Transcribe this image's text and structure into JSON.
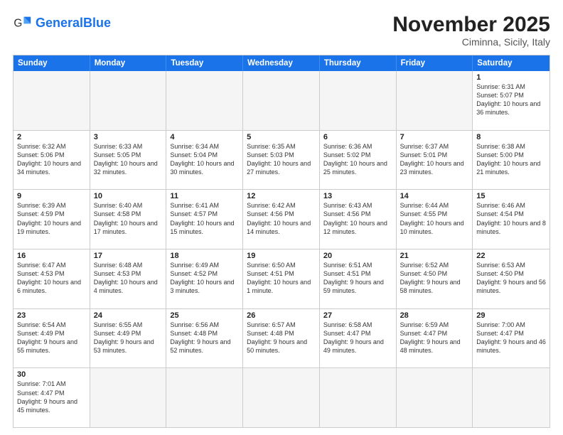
{
  "header": {
    "logo_general": "General",
    "logo_blue": "Blue",
    "month": "November 2025",
    "location": "Ciminna, Sicily, Italy"
  },
  "weekdays": [
    "Sunday",
    "Monday",
    "Tuesday",
    "Wednesday",
    "Thursday",
    "Friday",
    "Saturday"
  ],
  "weeks": [
    [
      {
        "day": "",
        "info": "",
        "empty": true
      },
      {
        "day": "",
        "info": "",
        "empty": true
      },
      {
        "day": "",
        "info": "",
        "empty": true
      },
      {
        "day": "",
        "info": "",
        "empty": true
      },
      {
        "day": "",
        "info": "",
        "empty": true
      },
      {
        "day": "",
        "info": "",
        "empty": true
      },
      {
        "day": "1",
        "info": "Sunrise: 6:31 AM\nSunset: 5:07 PM\nDaylight: 10 hours\nand 36 minutes.",
        "empty": false
      }
    ],
    [
      {
        "day": "2",
        "info": "Sunrise: 6:32 AM\nSunset: 5:06 PM\nDaylight: 10 hours\nand 34 minutes.",
        "empty": false
      },
      {
        "day": "3",
        "info": "Sunrise: 6:33 AM\nSunset: 5:05 PM\nDaylight: 10 hours\nand 32 minutes.",
        "empty": false
      },
      {
        "day": "4",
        "info": "Sunrise: 6:34 AM\nSunset: 5:04 PM\nDaylight: 10 hours\nand 30 minutes.",
        "empty": false
      },
      {
        "day": "5",
        "info": "Sunrise: 6:35 AM\nSunset: 5:03 PM\nDaylight: 10 hours\nand 27 minutes.",
        "empty": false
      },
      {
        "day": "6",
        "info": "Sunrise: 6:36 AM\nSunset: 5:02 PM\nDaylight: 10 hours\nand 25 minutes.",
        "empty": false
      },
      {
        "day": "7",
        "info": "Sunrise: 6:37 AM\nSunset: 5:01 PM\nDaylight: 10 hours\nand 23 minutes.",
        "empty": false
      },
      {
        "day": "8",
        "info": "Sunrise: 6:38 AM\nSunset: 5:00 PM\nDaylight: 10 hours\nand 21 minutes.",
        "empty": false
      }
    ],
    [
      {
        "day": "9",
        "info": "Sunrise: 6:39 AM\nSunset: 4:59 PM\nDaylight: 10 hours\nand 19 minutes.",
        "empty": false
      },
      {
        "day": "10",
        "info": "Sunrise: 6:40 AM\nSunset: 4:58 PM\nDaylight: 10 hours\nand 17 minutes.",
        "empty": false
      },
      {
        "day": "11",
        "info": "Sunrise: 6:41 AM\nSunset: 4:57 PM\nDaylight: 10 hours\nand 15 minutes.",
        "empty": false
      },
      {
        "day": "12",
        "info": "Sunrise: 6:42 AM\nSunset: 4:56 PM\nDaylight: 10 hours\nand 14 minutes.",
        "empty": false
      },
      {
        "day": "13",
        "info": "Sunrise: 6:43 AM\nSunset: 4:56 PM\nDaylight: 10 hours\nand 12 minutes.",
        "empty": false
      },
      {
        "day": "14",
        "info": "Sunrise: 6:44 AM\nSunset: 4:55 PM\nDaylight: 10 hours\nand 10 minutes.",
        "empty": false
      },
      {
        "day": "15",
        "info": "Sunrise: 6:46 AM\nSunset: 4:54 PM\nDaylight: 10 hours\nand 8 minutes.",
        "empty": false
      }
    ],
    [
      {
        "day": "16",
        "info": "Sunrise: 6:47 AM\nSunset: 4:53 PM\nDaylight: 10 hours\nand 6 minutes.",
        "empty": false
      },
      {
        "day": "17",
        "info": "Sunrise: 6:48 AM\nSunset: 4:53 PM\nDaylight: 10 hours\nand 4 minutes.",
        "empty": false
      },
      {
        "day": "18",
        "info": "Sunrise: 6:49 AM\nSunset: 4:52 PM\nDaylight: 10 hours\nand 3 minutes.",
        "empty": false
      },
      {
        "day": "19",
        "info": "Sunrise: 6:50 AM\nSunset: 4:51 PM\nDaylight: 10 hours\nand 1 minute.",
        "empty": false
      },
      {
        "day": "20",
        "info": "Sunrise: 6:51 AM\nSunset: 4:51 PM\nDaylight: 9 hours\nand 59 minutes.",
        "empty": false
      },
      {
        "day": "21",
        "info": "Sunrise: 6:52 AM\nSunset: 4:50 PM\nDaylight: 9 hours\nand 58 minutes.",
        "empty": false
      },
      {
        "day": "22",
        "info": "Sunrise: 6:53 AM\nSunset: 4:50 PM\nDaylight: 9 hours\nand 56 minutes.",
        "empty": false
      }
    ],
    [
      {
        "day": "23",
        "info": "Sunrise: 6:54 AM\nSunset: 4:49 PM\nDaylight: 9 hours\nand 55 minutes.",
        "empty": false
      },
      {
        "day": "24",
        "info": "Sunrise: 6:55 AM\nSunset: 4:49 PM\nDaylight: 9 hours\nand 53 minutes.",
        "empty": false
      },
      {
        "day": "25",
        "info": "Sunrise: 6:56 AM\nSunset: 4:48 PM\nDaylight: 9 hours\nand 52 minutes.",
        "empty": false
      },
      {
        "day": "26",
        "info": "Sunrise: 6:57 AM\nSunset: 4:48 PM\nDaylight: 9 hours\nand 50 minutes.",
        "empty": false
      },
      {
        "day": "27",
        "info": "Sunrise: 6:58 AM\nSunset: 4:47 PM\nDaylight: 9 hours\nand 49 minutes.",
        "empty": false
      },
      {
        "day": "28",
        "info": "Sunrise: 6:59 AM\nSunset: 4:47 PM\nDaylight: 9 hours\nand 48 minutes.",
        "empty": false
      },
      {
        "day": "29",
        "info": "Sunrise: 7:00 AM\nSunset: 4:47 PM\nDaylight: 9 hours\nand 46 minutes.",
        "empty": false
      }
    ],
    [
      {
        "day": "30",
        "info": "Sunrise: 7:01 AM\nSunset: 4:47 PM\nDaylight: 9 hours\nand 45 minutes.",
        "empty": false
      },
      {
        "day": "",
        "info": "",
        "empty": true
      },
      {
        "day": "",
        "info": "",
        "empty": true
      },
      {
        "day": "",
        "info": "",
        "empty": true
      },
      {
        "day": "",
        "info": "",
        "empty": true
      },
      {
        "day": "",
        "info": "",
        "empty": true
      },
      {
        "day": "",
        "info": "",
        "empty": true
      }
    ]
  ]
}
